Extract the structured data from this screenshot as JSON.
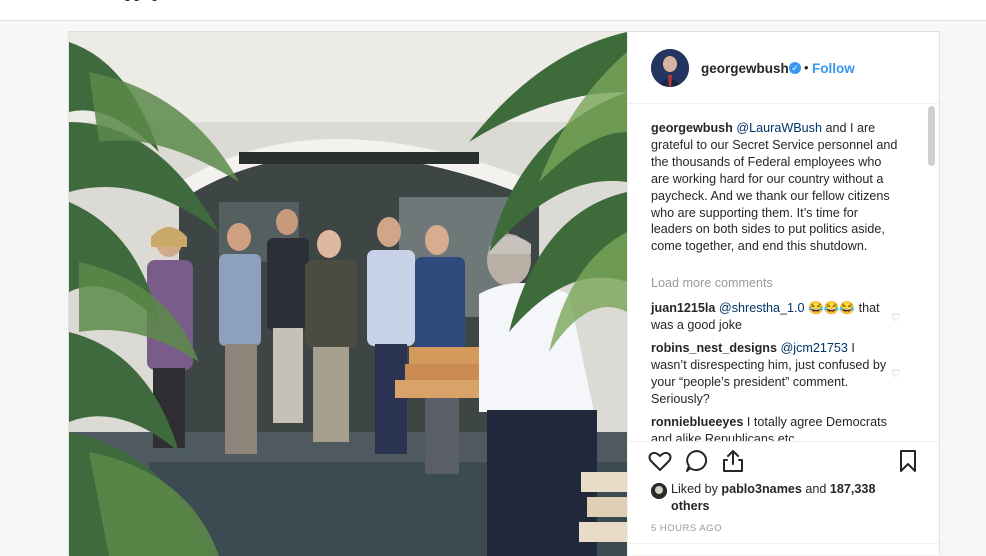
{
  "post": {
    "owner": "georgewbush",
    "follow_label": "Follow",
    "separator": "•",
    "verified_glyph": "✓",
    "caption_user": "georgewbush",
    "caption_mention": "@LauraWBush",
    "caption_text": " and I are grateful to our Secret Service personnel and the thousands of Federal employees who are working hard for our country without a paycheck. And we thank our fellow citizens who are supporting them. It’s time for leaders on both sides to put politics aside, come together, and end this shutdown.",
    "load_more": "Load more comments",
    "comments": [
      {
        "user": "juan1215la",
        "mention": "@shrestha_1.0",
        "text": " 😂😂😂 that was a good joke"
      },
      {
        "user": "robins_nest_designs",
        "mention": "@jcm21753",
        "text": " I wasn’t disrespecting him, just confused by your “people’s president” comment. Seriously?"
      },
      {
        "user": "ronnieblueeyes",
        "mention": "",
        "text": " I totally agree Democrats and alike Republicans etc"
      }
    ],
    "likes_prefix": "Liked by ",
    "likes_user": "pablo3names",
    "likes_mid": " and ",
    "likes_count": "187,338 others",
    "timestamp": "5 HOURS AGO",
    "icons": {
      "like": "heart-icon",
      "comment": "comment-icon",
      "share": "share-icon",
      "save": "bookmark-icon",
      "verified": "verified-badge-icon"
    },
    "colors": {
      "link": "#3897f0",
      "mention": "#003569",
      "muted": "#999999",
      "text": "#262626"
    }
  }
}
